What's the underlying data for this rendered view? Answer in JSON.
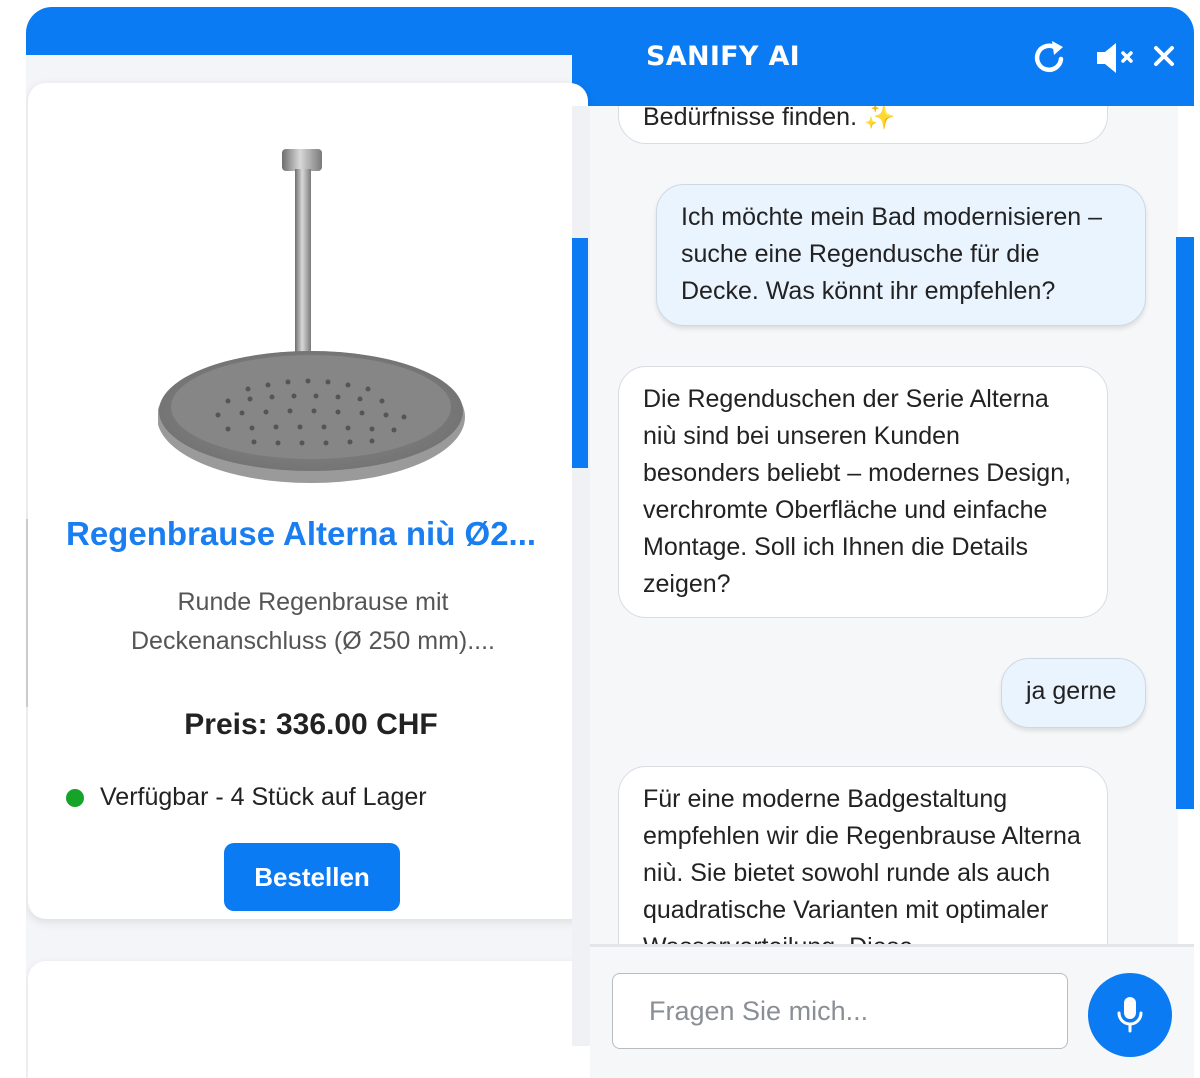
{
  "header": {
    "title": "SANIFY AI",
    "icons": [
      "refresh-icon",
      "mute-speaker-icon",
      "close-icon"
    ]
  },
  "product": {
    "title": "Regenbrause Alterna niù Ø2...",
    "description": "Runde Regenbrause mit Deckenanschluss (Ø 250 mm)....",
    "price": "Preis: 336.00 CHF",
    "stock": "Verfügbar - 4 Stück auf Lager",
    "order_label": "Bestellen",
    "image_icon": "rain-shower-head-image"
  },
  "chat": {
    "messages": [
      {
        "role": "bot",
        "text": "Bedürfnisse finden. ✨"
      },
      {
        "role": "user",
        "text": "Ich möchte mein Bad modernisieren – suche eine Regendusche für die Decke. Was könnt ihr empfehlen?"
      },
      {
        "role": "bot",
        "text": "Die Regenduschen der Serie Alterna niù sind bei unseren Kunden besonders beliebt – modernes Design, verchromte Oberfläche und einfache Montage. Soll ich Ihnen die Details zeigen?"
      },
      {
        "role": "user",
        "text": "ja gerne"
      },
      {
        "role": "bot",
        "text": "Für eine moderne Badgestaltung empfehlen wir die Regenbrause Alterna niù. Sie bietet sowohl runde als auch quadratische Varianten mit optimaler Wasserverteilung. Diese"
      }
    ],
    "input_placeholder": "Fragen Sie mich...",
    "input_value": ""
  },
  "colors": {
    "accent": "#0a7bf2",
    "product_title": "#1b7ef0",
    "stock_dot": "#15a32a",
    "user_bubble": "#e9f4ff"
  }
}
